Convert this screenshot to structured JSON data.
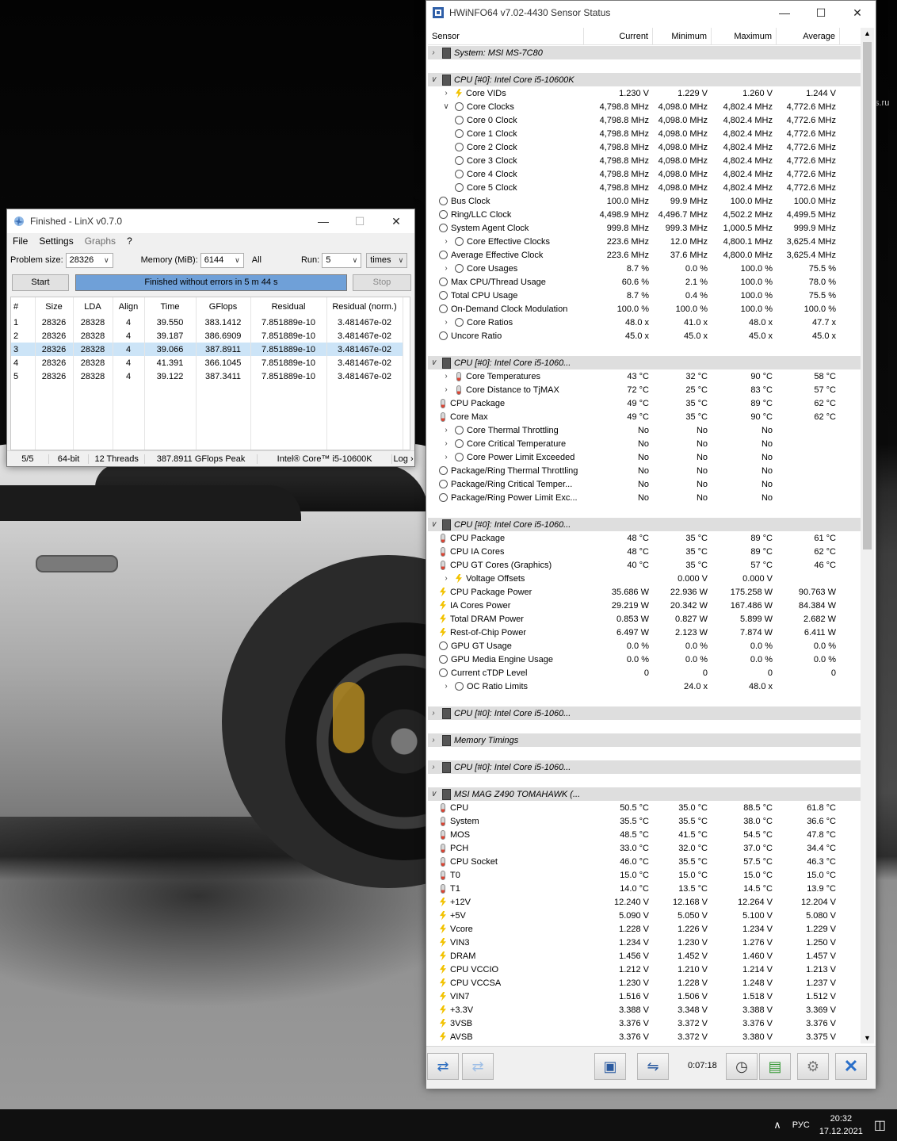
{
  "linx": {
    "title": "Finished - LinX v0.7.0",
    "menu": [
      "File",
      "Settings",
      "Graphs",
      "?"
    ],
    "problem_size_label": "Problem size:",
    "problem_size": "28326",
    "memory_label": "Memory (MiB):",
    "memory": "6144",
    "all_label": "All",
    "run_label": "Run:",
    "run": "5",
    "times": "times",
    "start": "Start",
    "progress_text": "Finished without errors in 5 m 44 s",
    "stop": "Stop",
    "columns": [
      "#",
      "Size",
      "LDA",
      "Align",
      "Time",
      "GFlops",
      "Residual",
      "Residual (norm.)"
    ],
    "rows": [
      [
        "1",
        "28326",
        "28328",
        "4",
        "39.550",
        "383.1412",
        "7.851889e-10",
        "3.481467e-02"
      ],
      [
        "2",
        "28326",
        "28328",
        "4",
        "39.187",
        "386.6909",
        "7.851889e-10",
        "3.481467e-02"
      ],
      [
        "3",
        "28326",
        "28328",
        "4",
        "39.066",
        "387.8911",
        "7.851889e-10",
        "3.481467e-02"
      ],
      [
        "4",
        "28326",
        "28328",
        "4",
        "41.391",
        "366.1045",
        "7.851889e-10",
        "3.481467e-02"
      ],
      [
        "5",
        "28326",
        "28328",
        "4",
        "39.122",
        "387.3411",
        "7.851889e-10",
        "3.481467e-02"
      ]
    ],
    "selected_row": 3,
    "status": [
      "5/5",
      "64-bit",
      "12 Threads",
      "387.8911 GFlops Peak",
      "Intel® Core™ i5-10600K",
      "Log ›"
    ]
  },
  "hw": {
    "title": "HWiNFO64 v7.02-4430 Sensor Status",
    "columns": [
      "Sensor",
      "Current",
      "Minimum",
      "Maximum",
      "Average"
    ],
    "rows": [
      {
        "t": "g",
        "n": "System: MSI MS-7C80",
        "x": ">"
      },
      {
        "t": "s"
      },
      {
        "t": "g",
        "n": "CPU [#0]: Intel Core i5-10600K",
        "x": "v"
      },
      {
        "t": "r",
        "n": "Core VIDs",
        "i": "bolt",
        "x": ">",
        "d": 2,
        "v": [
          "1.230 V",
          "1.229 V",
          "1.260 V",
          "1.244 V"
        ]
      },
      {
        "t": "r",
        "n": "Core Clocks",
        "i": "clock",
        "x": "v",
        "d": 2,
        "v": [
          "4,798.8 MHz",
          "4,098.0 MHz",
          "4,802.4 MHz",
          "4,772.6 MHz"
        ]
      },
      {
        "t": "r",
        "n": "Core 0 Clock",
        "i": "clock",
        "d": 2,
        "v": [
          "4,798.8 MHz",
          "4,098.0 MHz",
          "4,802.4 MHz",
          "4,772.6 MHz"
        ]
      },
      {
        "t": "r",
        "n": "Core 1 Clock",
        "i": "clock",
        "d": 2,
        "v": [
          "4,798.8 MHz",
          "4,098.0 MHz",
          "4,802.4 MHz",
          "4,772.6 MHz"
        ]
      },
      {
        "t": "r",
        "n": "Core 2 Clock",
        "i": "clock",
        "d": 2,
        "v": [
          "4,798.8 MHz",
          "4,098.0 MHz",
          "4,802.4 MHz",
          "4,772.6 MHz"
        ]
      },
      {
        "t": "r",
        "n": "Core 3 Clock",
        "i": "clock",
        "d": 2,
        "v": [
          "4,798.8 MHz",
          "4,098.0 MHz",
          "4,802.4 MHz",
          "4,772.6 MHz"
        ]
      },
      {
        "t": "r",
        "n": "Core 4 Clock",
        "i": "clock",
        "d": 2,
        "v": [
          "4,798.8 MHz",
          "4,098.0 MHz",
          "4,802.4 MHz",
          "4,772.6 MHz"
        ]
      },
      {
        "t": "r",
        "n": "Core 5 Clock",
        "i": "clock",
        "d": 2,
        "v": [
          "4,798.8 MHz",
          "4,098.0 MHz",
          "4,802.4 MHz",
          "4,772.6 MHz"
        ]
      },
      {
        "t": "r",
        "n": "Bus Clock",
        "i": "clock",
        "d": 1,
        "v": [
          "100.0 MHz",
          "99.9 MHz",
          "100.0 MHz",
          "100.0 MHz"
        ]
      },
      {
        "t": "r",
        "n": "Ring/LLC Clock",
        "i": "clock",
        "d": 1,
        "v": [
          "4,498.9 MHz",
          "4,496.7 MHz",
          "4,502.2 MHz",
          "4,499.5 MHz"
        ]
      },
      {
        "t": "r",
        "n": "System Agent Clock",
        "i": "clock",
        "d": 1,
        "v": [
          "999.8 MHz",
          "999.3 MHz",
          "1,000.5 MHz",
          "999.9 MHz"
        ]
      },
      {
        "t": "r",
        "n": "Core Effective Clocks",
        "i": "clock",
        "x": ">",
        "d": 2,
        "v": [
          "223.6 MHz",
          "12.0 MHz",
          "4,800.1 MHz",
          "3,625.4 MHz"
        ]
      },
      {
        "t": "r",
        "n": "Average Effective Clock",
        "i": "clock",
        "d": 1,
        "v": [
          "223.6 MHz",
          "37.6 MHz",
          "4,800.0 MHz",
          "3,625.4 MHz"
        ]
      },
      {
        "t": "r",
        "n": "Core Usages",
        "i": "clock",
        "x": ">",
        "d": 2,
        "v": [
          "8.7 %",
          "0.0 %",
          "100.0 %",
          "75.5 %"
        ]
      },
      {
        "t": "r",
        "n": "Max CPU/Thread Usage",
        "i": "clock",
        "d": 1,
        "v": [
          "60.6 %",
          "2.1 %",
          "100.0 %",
          "78.0 %"
        ]
      },
      {
        "t": "r",
        "n": "Total CPU Usage",
        "i": "clock",
        "d": 1,
        "v": [
          "8.7 %",
          "0.4 %",
          "100.0 %",
          "75.5 %"
        ]
      },
      {
        "t": "r",
        "n": "On-Demand Clock Modulation",
        "i": "clock",
        "d": 1,
        "v": [
          "100.0 %",
          "100.0 %",
          "100.0 %",
          "100.0 %"
        ]
      },
      {
        "t": "r",
        "n": "Core Ratios",
        "i": "clock",
        "x": ">",
        "d": 2,
        "v": [
          "48.0 x",
          "41.0 x",
          "48.0 x",
          "47.7 x"
        ]
      },
      {
        "t": "r",
        "n": "Uncore Ratio",
        "i": "clock",
        "d": 1,
        "v": [
          "45.0 x",
          "45.0 x",
          "45.0 x",
          "45.0 x"
        ]
      },
      {
        "t": "s"
      },
      {
        "t": "g",
        "n": "CPU [#0]: Intel Core i5-1060...",
        "x": "v"
      },
      {
        "t": "r",
        "n": "Core Temperatures",
        "i": "therm",
        "x": ">",
        "d": 2,
        "v": [
          "43 °C",
          "32 °C",
          "90 °C",
          "58 °C"
        ]
      },
      {
        "t": "r",
        "n": "Core Distance to TjMAX",
        "i": "therm",
        "x": ">",
        "d": 2,
        "v": [
          "72 °C",
          "25 °C",
          "83 °C",
          "57 °C"
        ]
      },
      {
        "t": "r",
        "n": "CPU Package",
        "i": "therm",
        "d": 1,
        "v": [
          "49 °C",
          "35 °C",
          "89 °C",
          "62 °C"
        ]
      },
      {
        "t": "r",
        "n": "Core Max",
        "i": "therm",
        "d": 1,
        "v": [
          "49 °C",
          "35 °C",
          "90 °C",
          "62 °C"
        ]
      },
      {
        "t": "r",
        "n": "Core Thermal Throttling",
        "i": "clock",
        "x": ">",
        "d": 2,
        "v": [
          "No",
          "No",
          "No",
          ""
        ]
      },
      {
        "t": "r",
        "n": "Core Critical Temperature",
        "i": "clock",
        "x": ">",
        "d": 2,
        "v": [
          "No",
          "No",
          "No",
          ""
        ]
      },
      {
        "t": "r",
        "n": "Core Power Limit Exceeded",
        "i": "clock",
        "x": ">",
        "d": 2,
        "v": [
          "No",
          "No",
          "No",
          ""
        ]
      },
      {
        "t": "r",
        "n": "Package/Ring Thermal Throttling",
        "i": "clock",
        "d": 1,
        "v": [
          "No",
          "No",
          "No",
          ""
        ]
      },
      {
        "t": "r",
        "n": "Package/Ring Critical Temper...",
        "i": "clock",
        "d": 1,
        "v": [
          "No",
          "No",
          "No",
          ""
        ]
      },
      {
        "t": "r",
        "n": "Package/Ring Power Limit Exc...",
        "i": "clock",
        "d": 1,
        "v": [
          "No",
          "No",
          "No",
          ""
        ]
      },
      {
        "t": "s"
      },
      {
        "t": "g",
        "n": "CPU [#0]: Intel Core i5-1060...",
        "x": "v"
      },
      {
        "t": "r",
        "n": "CPU Package",
        "i": "therm",
        "d": 1,
        "v": [
          "48 °C",
          "35 °C",
          "89 °C",
          "61 °C"
        ]
      },
      {
        "t": "r",
        "n": "CPU IA Cores",
        "i": "therm",
        "d": 1,
        "v": [
          "48 °C",
          "35 °C",
          "89 °C",
          "62 °C"
        ]
      },
      {
        "t": "r",
        "n": "CPU GT Cores (Graphics)",
        "i": "therm",
        "d": 1,
        "v": [
          "40 °C",
          "35 °C",
          "57 °C",
          "46 °C"
        ]
      },
      {
        "t": "r",
        "n": "Voltage Offsets",
        "i": "bolt",
        "x": ">",
        "d": 2,
        "v": [
          "",
          "0.000 V",
          "0.000 V",
          ""
        ]
      },
      {
        "t": "r",
        "n": "CPU Package Power",
        "i": "bolt",
        "d": 1,
        "v": [
          "35.686 W",
          "22.936 W",
          "175.258 W",
          "90.763 W"
        ]
      },
      {
        "t": "r",
        "n": "IA Cores Power",
        "i": "bolt",
        "d": 1,
        "v": [
          "29.219 W",
          "20.342 W",
          "167.486 W",
          "84.384 W"
        ]
      },
      {
        "t": "r",
        "n": "Total DRAM Power",
        "i": "bolt",
        "d": 1,
        "v": [
          "0.853 W",
          "0.827 W",
          "5.899 W",
          "2.682 W"
        ]
      },
      {
        "t": "r",
        "n": "Rest-of-Chip Power",
        "i": "bolt",
        "d": 1,
        "v": [
          "6.497 W",
          "2.123 W",
          "7.874 W",
          "6.411 W"
        ]
      },
      {
        "t": "r",
        "n": "GPU GT Usage",
        "i": "clock",
        "d": 1,
        "v": [
          "0.0 %",
          "0.0 %",
          "0.0 %",
          "0.0 %"
        ]
      },
      {
        "t": "r",
        "n": "GPU Media Engine Usage",
        "i": "clock",
        "d": 1,
        "v": [
          "0.0 %",
          "0.0 %",
          "0.0 %",
          "0.0 %"
        ]
      },
      {
        "t": "r",
        "n": "Current cTDP Level",
        "i": "clock",
        "d": 1,
        "v": [
          "0",
          "0",
          "0",
          "0"
        ]
      },
      {
        "t": "r",
        "n": "OC Ratio Limits",
        "i": "clock",
        "x": ">",
        "d": 2,
        "v": [
          "",
          "24.0 x",
          "48.0 x",
          ""
        ]
      },
      {
        "t": "s"
      },
      {
        "t": "g",
        "n": "CPU [#0]: Intel Core i5-1060...",
        "x": ">"
      },
      {
        "t": "s"
      },
      {
        "t": "g",
        "n": "Memory Timings",
        "x": ">"
      },
      {
        "t": "s"
      },
      {
        "t": "g",
        "n": "CPU [#0]: Intel Core i5-1060...",
        "x": ">"
      },
      {
        "t": "s"
      },
      {
        "t": "g",
        "n": "MSI MAG Z490 TOMAHAWK (...",
        "x": "v"
      },
      {
        "t": "r",
        "n": "CPU",
        "i": "therm",
        "d": 1,
        "v": [
          "50.5 °C",
          "35.0 °C",
          "88.5 °C",
          "61.8 °C"
        ]
      },
      {
        "t": "r",
        "n": "System",
        "i": "therm",
        "d": 1,
        "v": [
          "35.5 °C",
          "35.5 °C",
          "38.0 °C",
          "36.6 °C"
        ]
      },
      {
        "t": "r",
        "n": "MOS",
        "i": "therm",
        "d": 1,
        "v": [
          "48.5 °C",
          "41.5 °C",
          "54.5 °C",
          "47.8 °C"
        ]
      },
      {
        "t": "r",
        "n": "PCH",
        "i": "therm",
        "d": 1,
        "v": [
          "33.0 °C",
          "32.0 °C",
          "37.0 °C",
          "34.4 °C"
        ]
      },
      {
        "t": "r",
        "n": "CPU Socket",
        "i": "therm",
        "d": 1,
        "v": [
          "46.0 °C",
          "35.5 °C",
          "57.5 °C",
          "46.3 °C"
        ]
      },
      {
        "t": "r",
        "n": "T0",
        "i": "therm",
        "d": 1,
        "v": [
          "15.0 °C",
          "15.0 °C",
          "15.0 °C",
          "15.0 °C"
        ]
      },
      {
        "t": "r",
        "n": "T1",
        "i": "therm",
        "d": 1,
        "v": [
          "14.0 °C",
          "13.5 °C",
          "14.5 °C",
          "13.9 °C"
        ]
      },
      {
        "t": "r",
        "n": "+12V",
        "i": "bolt",
        "d": 1,
        "v": [
          "12.240 V",
          "12.168 V",
          "12.264 V",
          "12.204 V"
        ]
      },
      {
        "t": "r",
        "n": "+5V",
        "i": "bolt",
        "d": 1,
        "v": [
          "5.090 V",
          "5.050 V",
          "5.100 V",
          "5.080 V"
        ]
      },
      {
        "t": "r",
        "n": "Vcore",
        "i": "bolt",
        "d": 1,
        "v": [
          "1.228 V",
          "1.226 V",
          "1.234 V",
          "1.229 V"
        ]
      },
      {
        "t": "r",
        "n": "VIN3",
        "i": "bolt",
        "d": 1,
        "v": [
          "1.234 V",
          "1.230 V",
          "1.276 V",
          "1.250 V"
        ]
      },
      {
        "t": "r",
        "n": "DRAM",
        "i": "bolt",
        "d": 1,
        "v": [
          "1.456 V",
          "1.452 V",
          "1.460 V",
          "1.457 V"
        ]
      },
      {
        "t": "r",
        "n": "CPU VCCIO",
        "i": "bolt",
        "d": 1,
        "v": [
          "1.212 V",
          "1.210 V",
          "1.214 V",
          "1.213 V"
        ]
      },
      {
        "t": "r",
        "n": "CPU VCCSA",
        "i": "bolt",
        "d": 1,
        "v": [
          "1.230 V",
          "1.228 V",
          "1.248 V",
          "1.237 V"
        ]
      },
      {
        "t": "r",
        "n": "VIN7",
        "i": "bolt",
        "d": 1,
        "v": [
          "1.516 V",
          "1.506 V",
          "1.518 V",
          "1.512 V"
        ]
      },
      {
        "t": "r",
        "n": "+3.3V",
        "i": "bolt",
        "d": 1,
        "v": [
          "3.388 V",
          "3.348 V",
          "3.388 V",
          "3.369 V"
        ]
      },
      {
        "t": "r",
        "n": "3VSB",
        "i": "bolt",
        "d": 1,
        "v": [
          "3.376 V",
          "3.372 V",
          "3.376 V",
          "3.376 V"
        ]
      },
      {
        "t": "r",
        "n": "AVSB",
        "i": "bolt",
        "d": 1,
        "v": [
          "3.376 V",
          "3.372 V",
          "3.380 V",
          "3.375 V"
        ]
      }
    ],
    "elapsed": "0:07:18"
  },
  "taskbar": {
    "language": "РУС",
    "time": "20:32",
    "date": "17.12.2021"
  },
  "background_fragment": "s.ru"
}
